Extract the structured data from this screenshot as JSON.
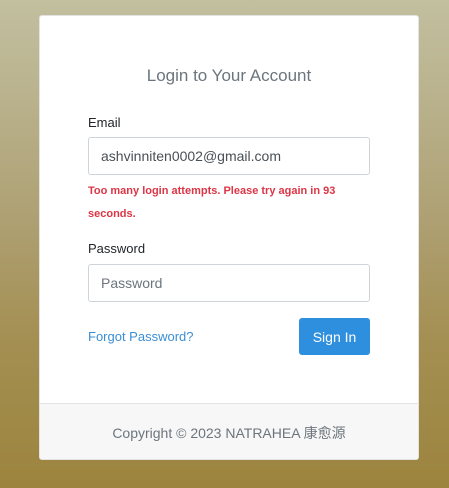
{
  "login": {
    "title": "Login to Your Account",
    "email_label": "Email",
    "email_value": "ashvinniten0002@gmail.com",
    "error_message": "Too many login attempts. Please try again in 93 seconds.",
    "password_label": "Password",
    "password_placeholder": "Password",
    "forgot_password": "Forgot Password?",
    "sign_in": "Sign In"
  },
  "footer": {
    "copyright": "Copyright © 2023 NATRAHEA 康愈源"
  },
  "colors": {
    "accent": "#2e8fde",
    "link": "#3b8ed4",
    "error": "#dc3545"
  }
}
